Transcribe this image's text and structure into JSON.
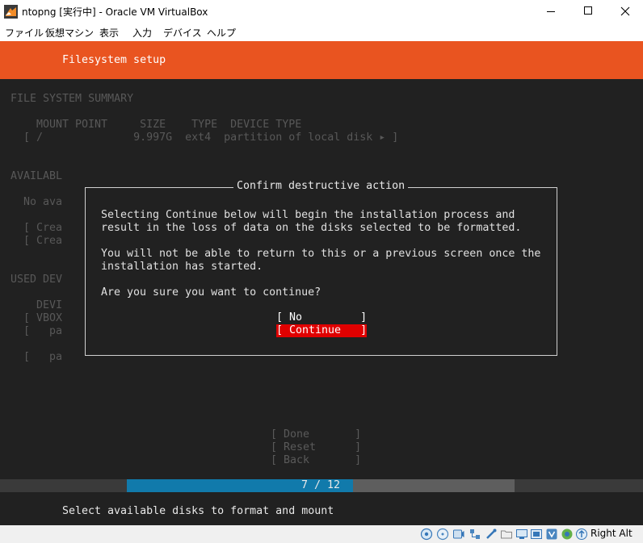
{
  "window": {
    "title": "ntopng [実行中] - Oracle VM VirtualBox"
  },
  "menu": [
    "ファイル",
    "仮想マシン",
    "表示",
    "入力",
    "デバイス",
    "ヘルプ"
  ],
  "installer": {
    "header": "Filesystem setup",
    "fs_summary_heading": "FILE SYSTEM SUMMARY",
    "fs_columns": "MOUNT POINT     SIZE    TYPE  DEVICE TYPE",
    "fs_row": "[ /              9.997G  ext4  partition of local disk ▸ ]",
    "available_heading": "AVAILABL",
    "no_available": "No ava",
    "create_1": "[ Crea",
    "create_2": "[ Crea",
    "used_heading": "USED DEV",
    "used_col": "DEVI",
    "used_vbox": "[ VBOX",
    "used_pa1": "[   pa",
    "used_pa2": "[   pa",
    "buttons": {
      "done": "[ Done       ]",
      "reset": "[ Reset      ]",
      "back": "[ Back       ]"
    },
    "progress": {
      "label": "7 / 12",
      "current": 7,
      "total": 12
    },
    "footer": "Select available disks to format and mount"
  },
  "dialog": {
    "title": "Confirm destructive action",
    "line1": "Selecting Continue below will begin the installation process and",
    "line2": "result in the loss of data on the disks selected to be formatted.",
    "line3": "You will not be able to return to this or a previous screen once the",
    "line4": "installation has started.",
    "question": "Are you sure you want to continue?",
    "no_button": "[ No         ]",
    "continue_button": "[ Continue   ]",
    "accent_color": "#e00000"
  },
  "statusbar": {
    "host_key": "Right Alt",
    "icons": [
      "hard-disk-icon",
      "optical-drive-icon",
      "audio-icon",
      "network-icon",
      "usb-icon",
      "shared-folder-icon",
      "display-icon",
      "video-capture-icon",
      "recording-icon",
      "virtualization-icon",
      "mouse-integration-icon",
      "keyboard-icon"
    ]
  }
}
